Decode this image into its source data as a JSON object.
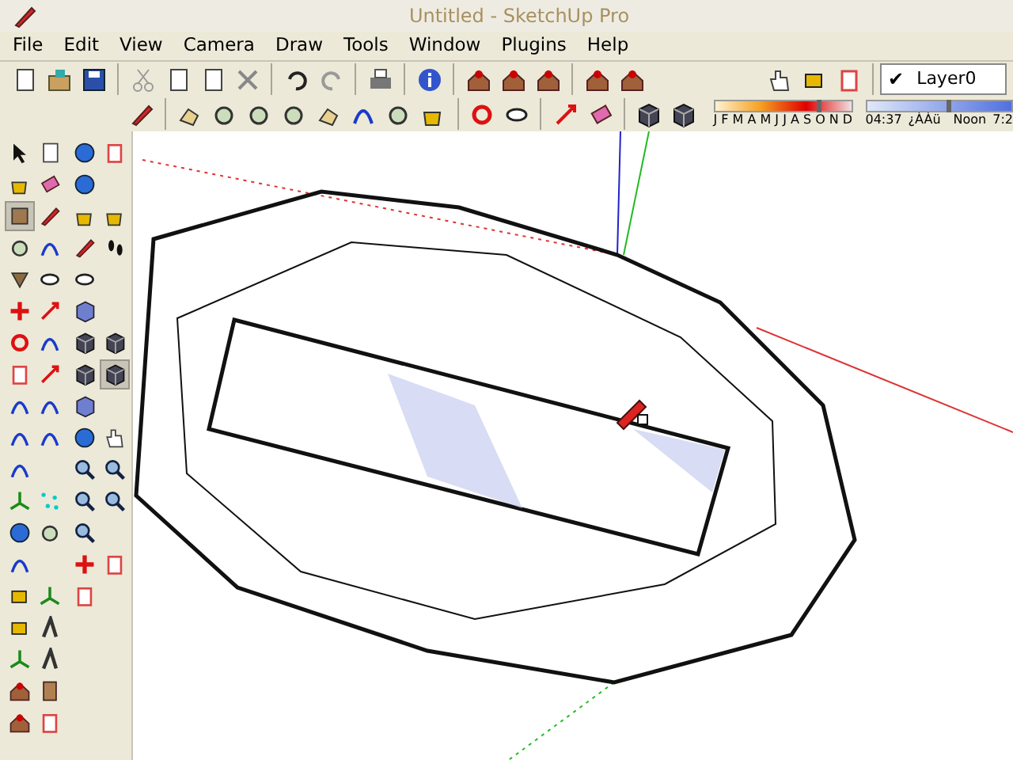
{
  "window": {
    "title": "Untitled - SketchUp Pro"
  },
  "menu": [
    "File",
    "Edit",
    "View",
    "Camera",
    "Draw",
    "Tools",
    "Window",
    "Plugins",
    "Help"
  ],
  "layer": {
    "name": "Layer0",
    "checked": true,
    "mark": "✔"
  },
  "shadow_timeline": {
    "months": [
      "J",
      "F",
      "M",
      "A",
      "M",
      "J",
      "J",
      "A",
      "S",
      "O",
      "N",
      "D"
    ],
    "month_slider": {
      "level": 0.75
    },
    "time": "04:37",
    "am_label": "¿ÀÀü",
    "noon": "Noon",
    "time_end": "7:2",
    "time_slider": {
      "level": 0.55
    }
  }
}
